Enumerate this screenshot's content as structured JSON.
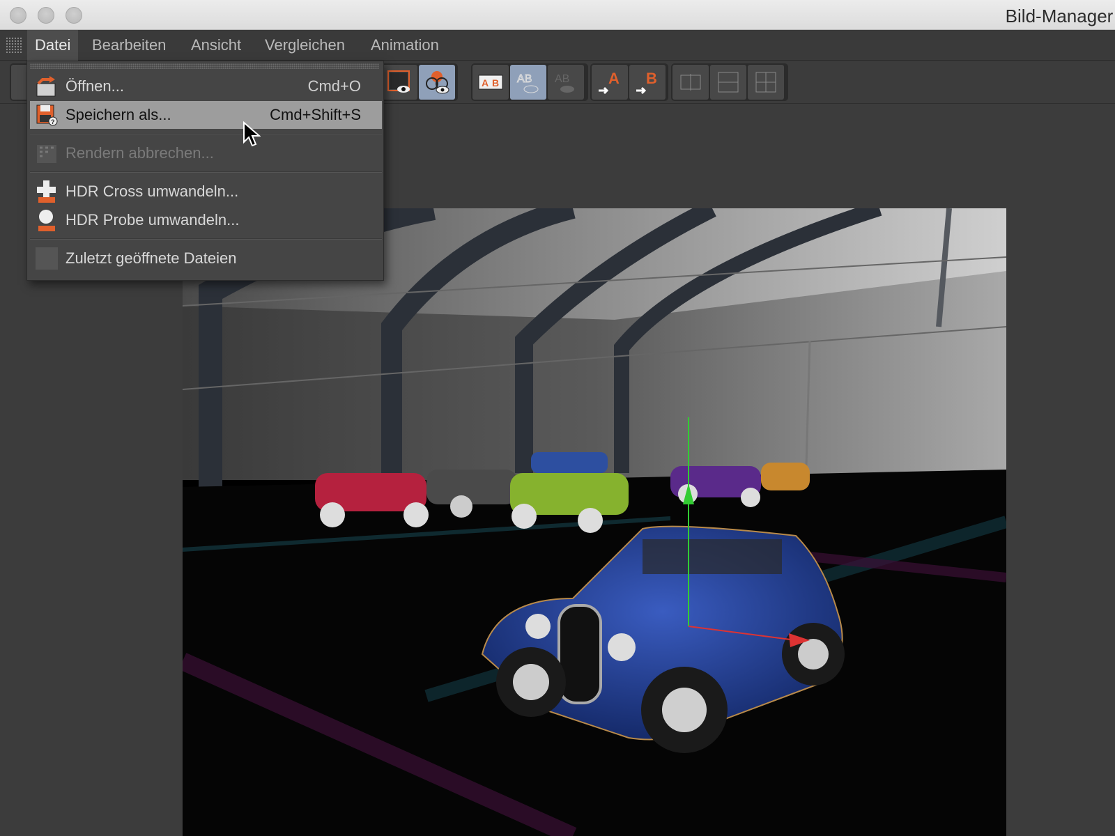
{
  "window": {
    "title": "Bild-Manager"
  },
  "menubar": {
    "items": [
      {
        "label": "Datei",
        "active": true
      },
      {
        "label": "Bearbeiten"
      },
      {
        "label": "Ansicht"
      },
      {
        "label": "Vergleichen"
      },
      {
        "label": "Animation"
      }
    ]
  },
  "dropdown": {
    "items": [
      {
        "label": "Öffnen...",
        "shortcut": "Cmd+O",
        "icon": "open-folder-icon"
      },
      {
        "label": "Speichern als...",
        "shortcut": "Cmd+Shift+S",
        "icon": "save-as-icon",
        "highlighted": true
      },
      {
        "label": "Rendern abbrechen...",
        "icon": "cancel-render-icon",
        "disabled": true
      },
      {
        "label": "HDR Cross umwandeln...",
        "icon": "hdr-cross-icon"
      },
      {
        "label": "HDR Probe umwandeln...",
        "icon": "hdr-probe-icon"
      },
      {
        "label": "Zuletzt geöffnete Dateien",
        "icon": "recent-files-icon"
      }
    ]
  },
  "toolbar": {
    "ab_label_a": "A",
    "ab_label_b": "B"
  },
  "colors": {
    "accent_orange": "#e0602c",
    "toggle_active": "#8fa0b9",
    "menu_highlight": "#9d9d9d"
  }
}
